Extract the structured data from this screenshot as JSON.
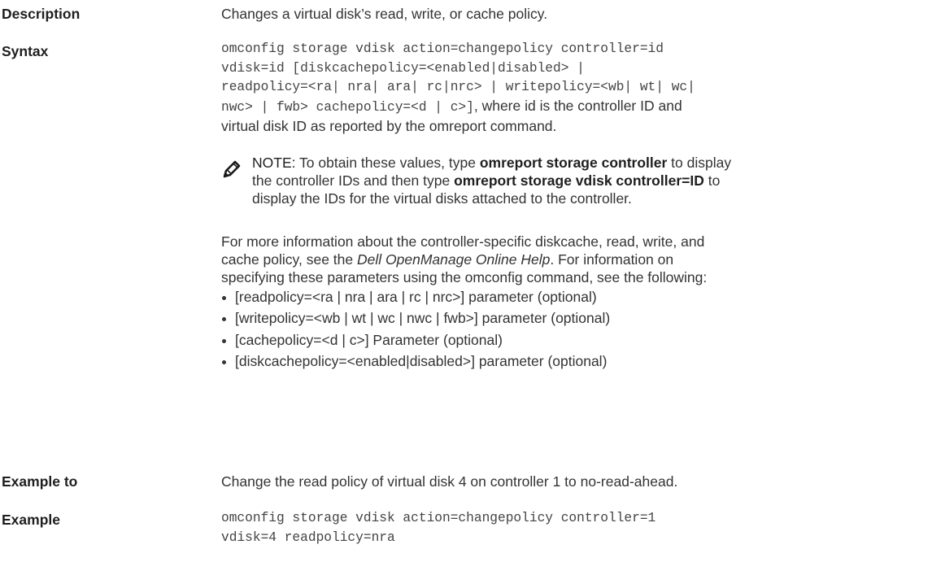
{
  "description": {
    "label": "Description",
    "text": "Changes a virtual disk’s read, write, or cache policy."
  },
  "syntax": {
    "label": "Syntax",
    "code_lines": [
      "omconfig storage vdisk action=changepolicy controller=id",
      "vdisk=id [diskcachepolicy=<enabled|disabled> |",
      "readpolicy=<ra| nra| ara| rc|nrc> | writepolicy=<wb| wt| wc|"
    ],
    "code_last": "nwc> | fwb> cachepolicy=<d | c>]",
    "code_last_tail": ", where id is the controller ID and",
    "text_line": "virtual disk ID as reported by the omreport command."
  },
  "note": {
    "prefix": "NOTE:",
    "t1": " To obtain these values, type ",
    "b1": "omreport storage controller",
    "t2": " to display",
    "t3": "the controller IDs and then type ",
    "b2": "omreport storage vdisk controller=ID",
    "t4": " to",
    "t5": "display the IDs for the virtual disks attached to the controller."
  },
  "more_info": {
    "l1": "For more information about the controller-specific diskcache, read, write, and",
    "l2a": "cache policy, see the ",
    "l2i": "Dell OpenManage Online Help",
    "l2b": ". For information on",
    "l3": "specifying these parameters using the omconfig command, see the following:"
  },
  "bullets": [
    "[readpolicy=<ra | nra | ara | rc | nrc>] parameter (optional)",
    "[writepolicy=<wb | wt | wc | nwc | fwb>] parameter (optional)",
    "[cachepolicy=<d | c>] Parameter (optional)",
    "[diskcachepolicy=<enabled|disabled>] parameter (optional)"
  ],
  "example_to": {
    "label": "Example to",
    "text": "Change the read policy of virtual disk 4 on controller 1 to no-read-ahead."
  },
  "example": {
    "label": "Example",
    "code_lines": [
      "omconfig storage vdisk action=changepolicy controller=1",
      "vdisk=4 readpolicy=nra"
    ]
  }
}
